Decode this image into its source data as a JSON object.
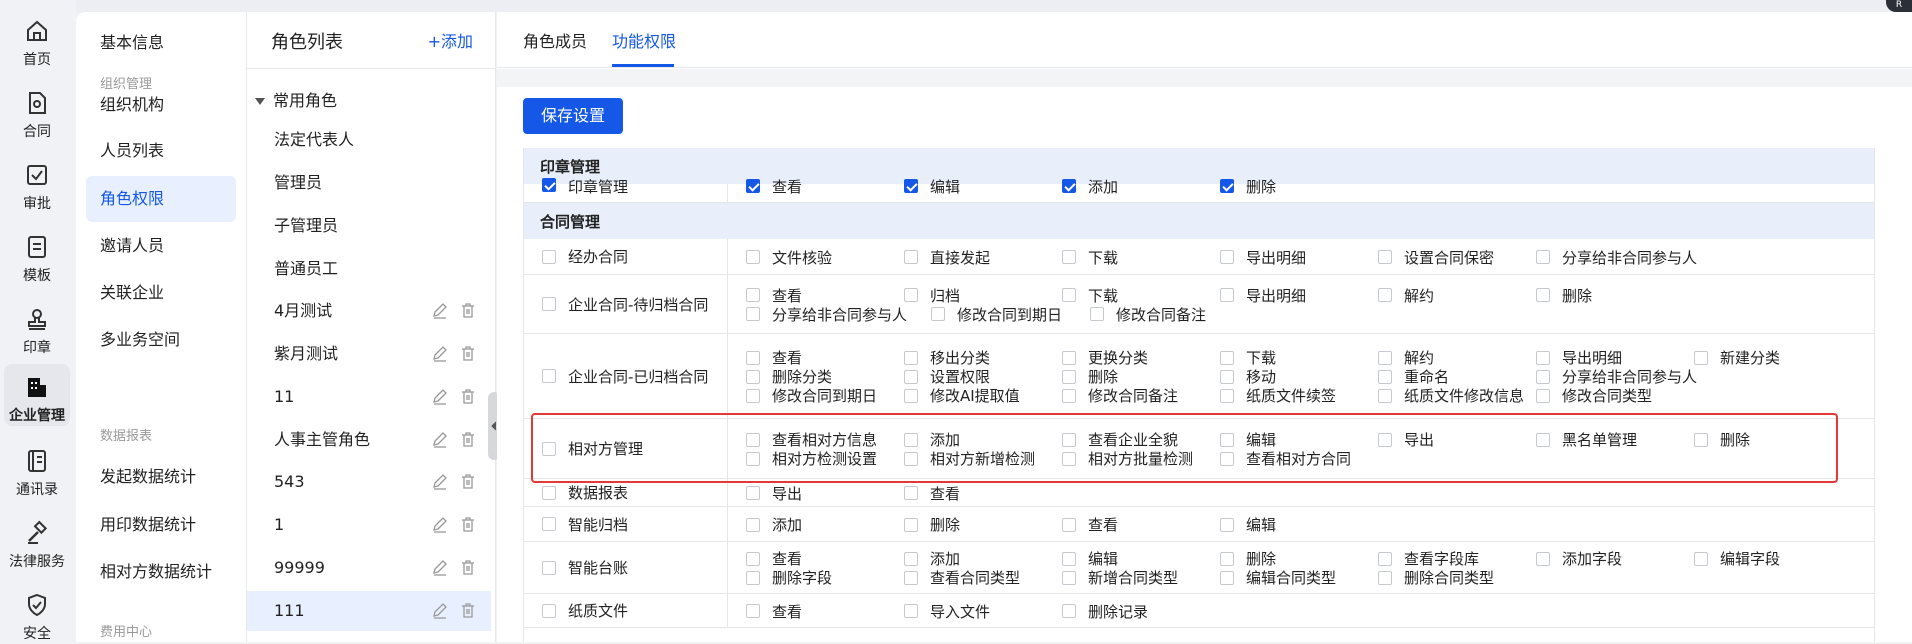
{
  "nav": [
    {
      "label": "首页",
      "icon": "home-icon"
    },
    {
      "label": "合同",
      "icon": "contract-icon"
    },
    {
      "label": "审批",
      "icon": "approval-icon"
    },
    {
      "label": "模板",
      "icon": "template-icon"
    },
    {
      "label": "印章",
      "icon": "seal-icon"
    },
    {
      "label": "企业管理",
      "icon": "enterprise-icon",
      "active": true
    },
    {
      "label": "通讯录",
      "icon": "contacts-icon"
    },
    {
      "label": "法律服务",
      "icon": "legal-icon"
    },
    {
      "label": "安全",
      "icon": "shield-icon"
    }
  ],
  "menu": {
    "basic": "基本信息",
    "group1": "组织管理",
    "items1": [
      "组织机构",
      "人员列表",
      "角色权限",
      "邀请人员",
      "关联企业",
      "多业务空间"
    ],
    "group2": "数据报表",
    "items2": [
      "发起数据统计",
      "用印数据统计",
      "相对方数据统计"
    ],
    "group3": "费用中心"
  },
  "roles": {
    "title": "角色列表",
    "add": "+添加",
    "group": "常用角色",
    "fixed": [
      "法定代表人",
      "管理员",
      "子管理员",
      "普通员工"
    ],
    "custom": [
      "4月测试",
      "紫月测试",
      "11",
      "人事主管角色",
      "543",
      "1",
      "99999",
      "111"
    ]
  },
  "tabs": [
    "角色成员",
    "功能权限"
  ],
  "save_label": "保存设置",
  "sections": [
    {
      "title": "印章管理",
      "partial": {
        "name": "印章管理",
        "perms": [
          "查看",
          "编辑",
          "添加",
          "删除"
        ]
      }
    },
    {
      "title": "合同管理"
    }
  ],
  "rows": [
    {
      "name": "经办合同",
      "lines": [
        [
          "文件核验",
          "直接发起",
          "下载",
          "导出明细",
          "设置合同保密",
          "分享给非合同参与人"
        ]
      ]
    },
    {
      "name": "企业合同-待归档合同",
      "lines": [
        [
          "查看",
          "归档",
          "下载",
          "导出明细",
          "解约",
          "删除"
        ],
        [
          "分享给非合同参与人",
          "修改合同到期日",
          "修改合同备注"
        ]
      ]
    },
    {
      "name": "企业合同-已归档合同",
      "lines": [
        [
          "查看",
          "移出分类",
          "更换分类",
          "下载",
          "解约",
          "导出明细",
          "新建分类"
        ],
        [
          "删除分类",
          "设置权限",
          "删除",
          "移动",
          "重命名",
          "分享给非合同参与人"
        ],
        [
          "修改合同到期日",
          "修改AI提取值",
          "修改合同备注",
          "纸质文件续签",
          "纸质文件修改信息",
          "修改合同类型"
        ]
      ]
    },
    {
      "name": "相对方管理",
      "lines": [
        [
          "查看相对方信息",
          "添加",
          "查看企业全貌",
          "编辑",
          "导出",
          "黑名单管理",
          "删除"
        ],
        [
          "相对方检测设置",
          "相对方新增检测",
          "相对方批量检测",
          "查看相对方合同"
        ]
      ]
    },
    {
      "name": "数据报表",
      "lines": [
        [
          "导出",
          "查看"
        ]
      ]
    },
    {
      "name": "智能归档",
      "lines": [
        [
          "添加",
          "删除",
          "查看",
          "编辑"
        ]
      ]
    },
    {
      "name": "智能台账",
      "lines": [
        [
          "查看",
          "添加",
          "编辑",
          "删除",
          "查看字段库",
          "添加字段",
          "编辑字段"
        ],
        [
          "删除字段",
          "查看合同类型",
          "新增合同类型",
          "编辑合同类型",
          "删除合同类型"
        ]
      ]
    },
    {
      "name": "纸质文件",
      "lines": [
        [
          "查看",
          "导入文件",
          "删除记录"
        ]
      ]
    }
  ],
  "corner_label": "R",
  "colors": {
    "accent": "#1558e8",
    "highlight": "#e53935"
  }
}
